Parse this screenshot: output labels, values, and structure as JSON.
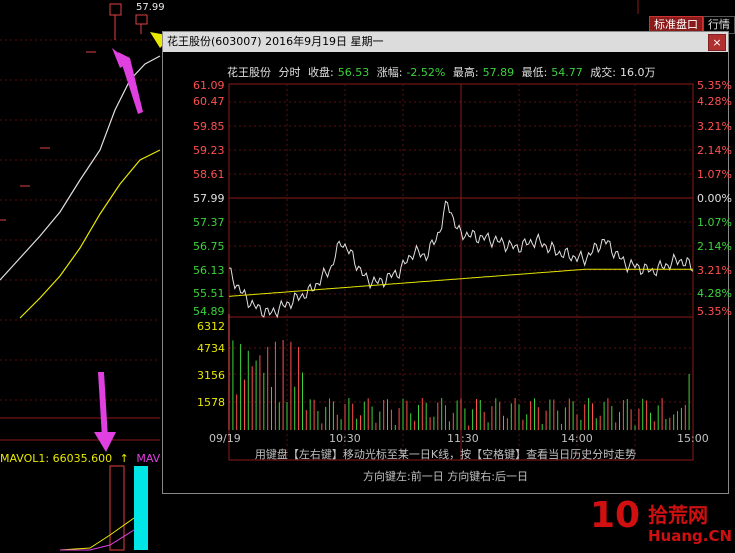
{
  "header": {
    "tabs": [
      {
        "label": "标准盘口",
        "active": true
      },
      {
        "label": "行情",
        "active": false
      }
    ]
  },
  "background_chart": {
    "price_label": "57.99",
    "mavol": [
      {
        "label": "MAVOL1: 66035.600",
        "color": "#e8e800"
      },
      {
        "label": "↑",
        "color": "#e8e800"
      },
      {
        "label": "MAV",
        "color": "#e040e0"
      }
    ]
  },
  "popup": {
    "title": "花王股份(603007) 2016年9月19日 星期一",
    "close_label": "×",
    "info": {
      "name": "花王股份",
      "mode": "分时",
      "close_label": "收盘:",
      "close_value": "56.53",
      "change_label": "涨幅:",
      "change_value": "-2.52%",
      "high_label": "最高:",
      "high_value": "57.89",
      "low_label": "最低:",
      "low_value": "54.77",
      "volume_label": "成交:",
      "volume_value": "16.0万"
    },
    "price_axis_left": [
      "61.09",
      "60.47",
      "59.85",
      "59.23",
      "58.61",
      "57.99",
      "57.37",
      "56.75",
      "56.13",
      "55.51",
      "54.89"
    ],
    "price_axis_right": [
      "5.35%",
      "4.28%",
      "3.21%",
      "2.14%",
      "1.07%",
      "0.00%",
      "1.07%",
      "2.14%",
      "3.21%",
      "4.28%",
      "5.35%"
    ],
    "volume_axis": [
      "6312",
      "4734",
      "3156",
      "1578"
    ],
    "time_axis": [
      "09/19",
      "10:30",
      "11:30",
      "14:00",
      "15:00"
    ],
    "hint_line1": "用键盘【左右键】移动光标至某一日K线，按【空格键】查看当日历史分时走势",
    "hint_line2": "方向键左:前一日    方向键右:后一日",
    "colors": {
      "up": "#ff5050",
      "down": "#3cd23c",
      "flat": "#e0e0e0",
      "avg": "#e8e800"
    }
  },
  "logo": {
    "number": "10",
    "cn": "拾荒网",
    "url": "Huang.CN"
  }
}
